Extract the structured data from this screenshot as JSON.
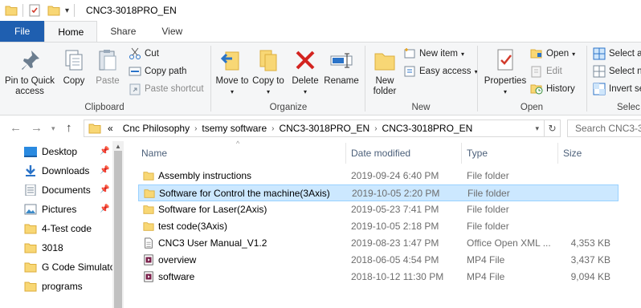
{
  "window": {
    "title": "CNC3-3018PRO_EN"
  },
  "tabs": [
    "File",
    "Home",
    "Share",
    "View"
  ],
  "ribbon": {
    "clipboard": {
      "label": "Clipboard",
      "pin_quick_access": "Pin to Quick access",
      "copy": "Copy",
      "paste": "Paste",
      "cut": "Cut",
      "copy_path": "Copy path",
      "paste_shortcut": "Paste shortcut"
    },
    "organize": {
      "label": "Organize",
      "move_to": "Move to",
      "copy_to": "Copy to",
      "delete": "Delete",
      "rename": "Rename"
    },
    "new": {
      "label": "New",
      "new_folder": "New folder",
      "new_item": "New item",
      "easy_access": "Easy access"
    },
    "open": {
      "label": "Open",
      "properties": "Properties",
      "open": "Open",
      "edit": "Edit",
      "history": "History"
    },
    "select": {
      "label": "Selec",
      "select_all": "Select al",
      "select_none": "Select n",
      "invert": "Invert se"
    }
  },
  "address": {
    "overflow": "«",
    "crumbs": [
      "Cnc Philosophy",
      "tsemy software",
      "CNC3-3018PRO_EN",
      "CNC3-3018PRO_EN"
    ]
  },
  "search": {
    "placeholder": "Search CNC3-30"
  },
  "nav_pane": {
    "items": [
      {
        "label": "Desktop",
        "pinned": true
      },
      {
        "label": "Downloads",
        "pinned": true
      },
      {
        "label": "Documents",
        "pinned": true
      },
      {
        "label": "Pictures",
        "pinned": true
      },
      {
        "label": "4-Test code",
        "pinned": false
      },
      {
        "label": "3018",
        "pinned": false
      },
      {
        "label": "G Code Simulato",
        "pinned": false
      },
      {
        "label": "programs",
        "pinned": false
      }
    ]
  },
  "columns": {
    "name": "Name",
    "date": "Date modified",
    "type": "Type",
    "size": "Size"
  },
  "files": [
    {
      "name": "Assembly instructions",
      "date": "2019-09-24 6:40 PM",
      "type": "File folder",
      "size": "",
      "icon": "folder-icon",
      "selected": false
    },
    {
      "name": "Software for Control the machine(3Axis)",
      "date": "2019-10-05 2:20 PM",
      "type": "File folder",
      "size": "",
      "icon": "folder-icon",
      "selected": true
    },
    {
      "name": "Software for Laser(2Axis)",
      "date": "2019-05-23 7:41 PM",
      "type": "File folder",
      "size": "",
      "icon": "folder-icon",
      "selected": false
    },
    {
      "name": "test code(3Axis)",
      "date": "2019-10-05 2:18 PM",
      "type": "File folder",
      "size": "",
      "icon": "folder-icon",
      "selected": false
    },
    {
      "name": "CNC3 User Manual_V1.2",
      "date": "2019-08-23 1:47 PM",
      "type": "Office Open XML ...",
      "size": "4,353 KB",
      "icon": "document-icon",
      "selected": false
    },
    {
      "name": "overview",
      "date": "2018-06-05 4:54 PM",
      "type": "MP4 File",
      "size": "3,437 KB",
      "icon": "video-icon",
      "selected": false
    },
    {
      "name": "software",
      "date": "2018-10-12 11:30 PM",
      "type": "MP4 File",
      "size": "9,094 KB",
      "icon": "video-icon",
      "selected": false
    }
  ],
  "colors": {
    "file_tab": "#1f5fb0",
    "selection": "#cce8ff",
    "selection_border": "#99d1ff",
    "folder": "#f8d775"
  }
}
